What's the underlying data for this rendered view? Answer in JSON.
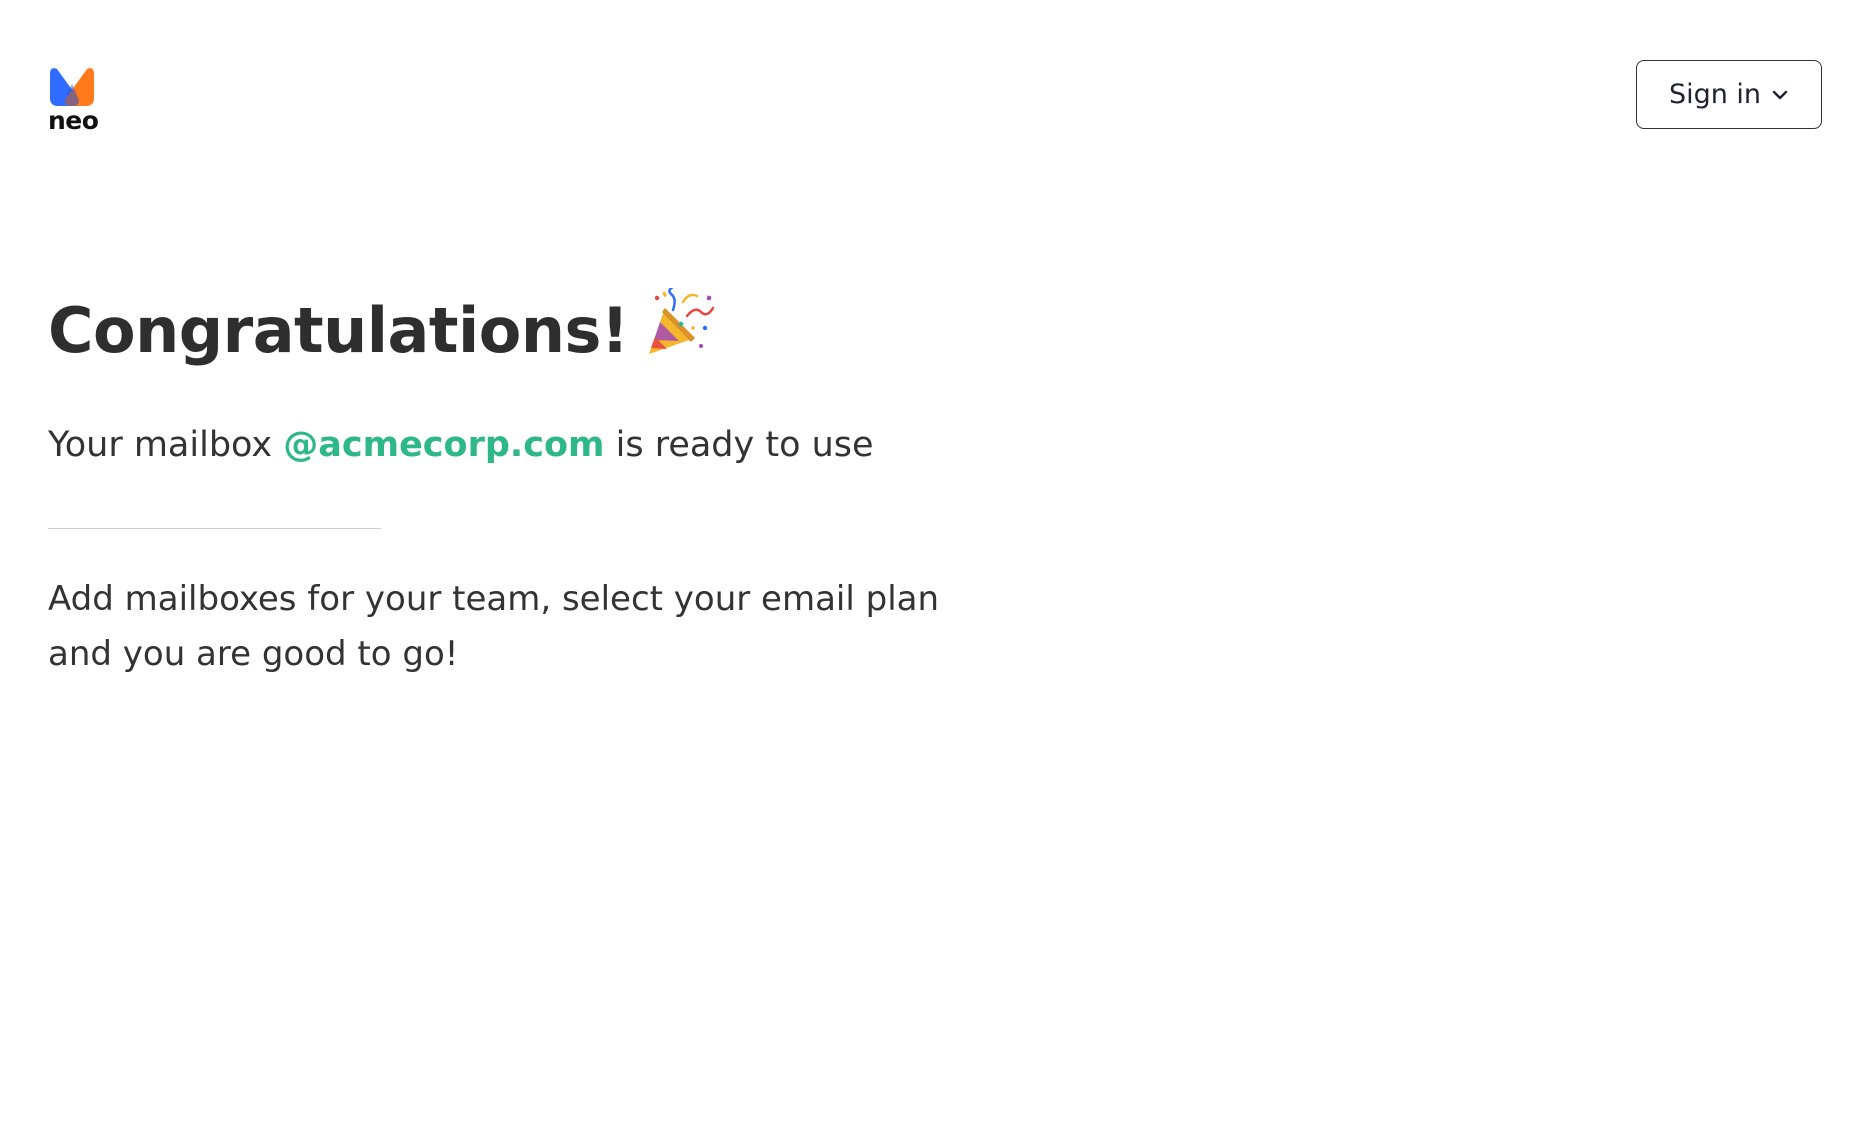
{
  "header": {
    "logo": {
      "icon": "neo-logo-icon",
      "wordmark": "neo",
      "colors": {
        "blue": "#2f6bff",
        "orange": "#ff7a1a"
      }
    },
    "signin_button": {
      "label": "Sign in",
      "icon": "chevron-down-icon"
    }
  },
  "main": {
    "headline": "Congratulations!",
    "headline_icon": "party-popper-icon",
    "subline": {
      "prefix": "Your mailbox ",
      "domain": "@acmecorp.com",
      "suffix": " is ready to use"
    },
    "body_lines": [
      "Add mailboxes for your team, select your email plan",
      "and you are good to go!"
    ]
  },
  "colors": {
    "accent_green": "#2eb887",
    "text_dark": "#2e2e2e",
    "button_border": "#2d3142"
  }
}
